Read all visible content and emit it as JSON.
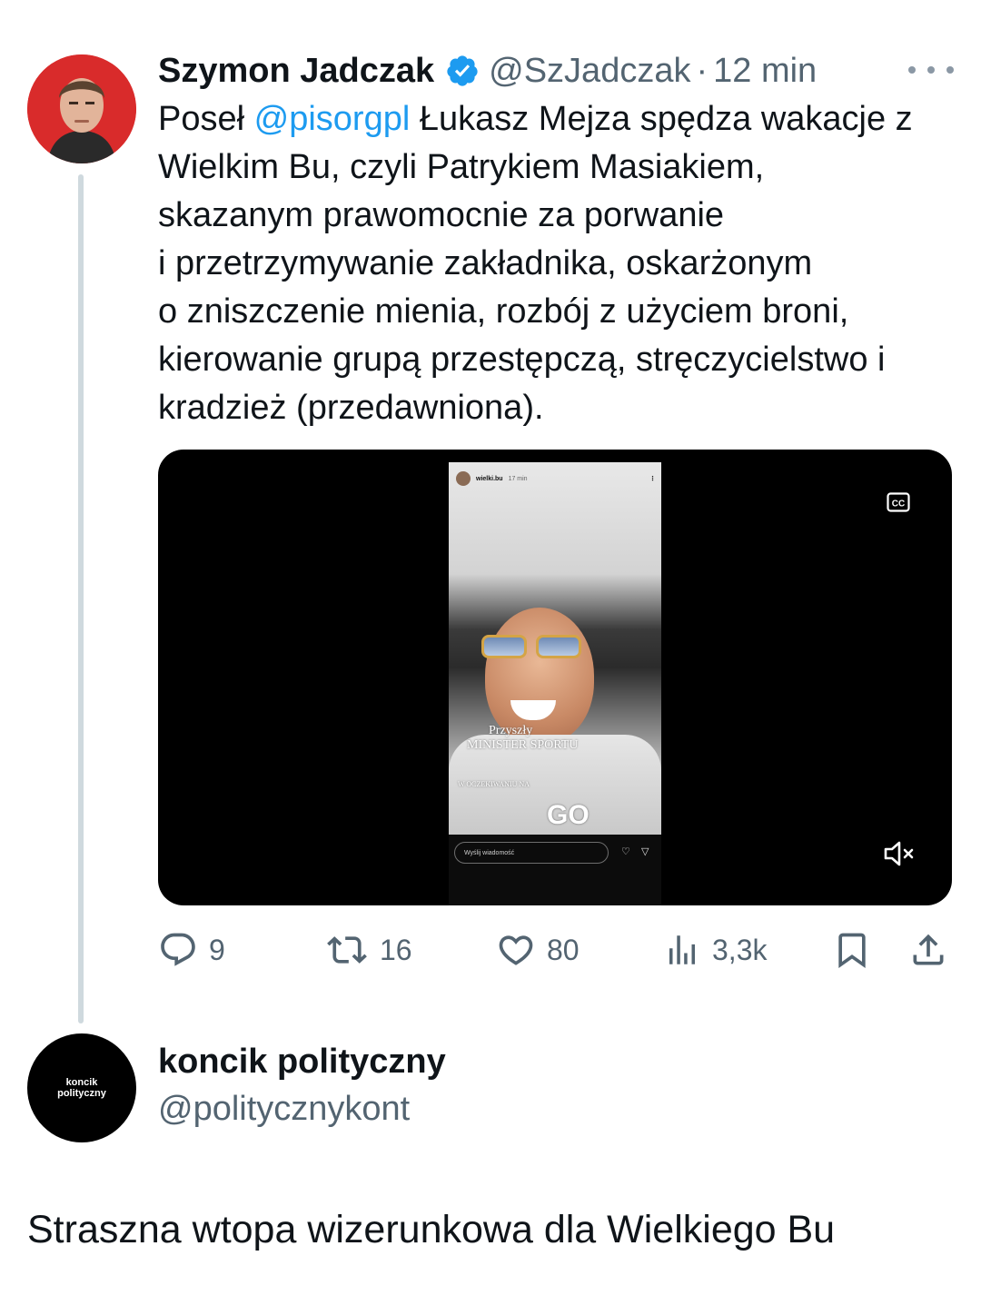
{
  "tweet": {
    "author": {
      "name": "Szymon Jadczak",
      "handle": "@SzJadczak",
      "separator": "·",
      "time": "12 min",
      "verified": true,
      "avatar_icon": "person-photo"
    },
    "text": {
      "line1_before": "Poseł ",
      "mention": "@pisorgpl",
      "line1_after": " Łukasz Mejza spędza wakacje z",
      "rest": "Wielkim Bu, czyli Patrykiem Masiakiem,\nskazanym prawomocnie za porwanie\ni przetrzymywanie zakładnika, oskarżonym\no zniszczenie mienia, rozbój z użyciem broni,\nkierowanie grupą przestępczą, stręczycielstwo i\nkradzież (przedawniona)."
    },
    "media": {
      "story_user": "wielki.bu",
      "story_time": "17 min",
      "caption_1": "Przyszły",
      "caption_2": "MINISTER SPORTU",
      "caption_3": "W OCZEKIWANIU NA",
      "caption_go": "GO",
      "reply_placeholder": "Wyślij wiadomość",
      "cc_icon": "closed-captions-icon",
      "mute_icon": "speaker-muted-icon"
    },
    "stats": {
      "replies": "9",
      "retweets": "16",
      "likes": "80",
      "views": "3,3k"
    }
  },
  "reply": {
    "author": {
      "name": "koncik polityczny",
      "handle": "@politycznykont",
      "avatar_line1": "koncik",
      "avatar_line2": "polityczny"
    },
    "text": "Straszna wtopa wizerunkowa dla Wielkiego Bu"
  },
  "colors": {
    "accent": "#1d9bf0",
    "secondary_text": "#536471",
    "thread_line": "#cfd9de",
    "avatar_red": "#d92b2b"
  }
}
